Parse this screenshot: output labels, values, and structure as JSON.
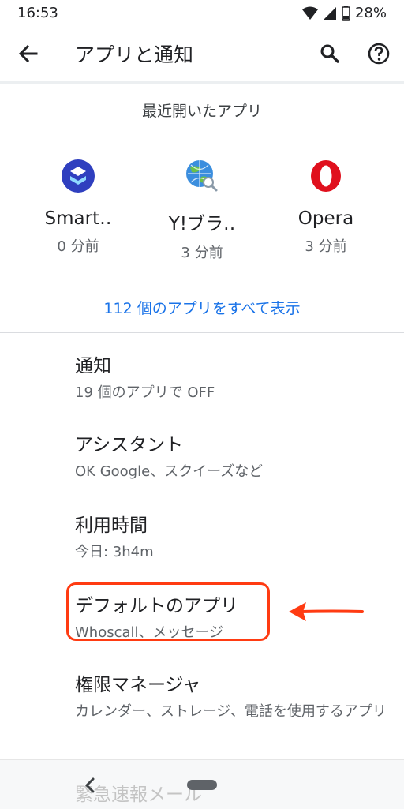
{
  "status_bar": {
    "time": "16:53",
    "battery_text": "28%",
    "icons": [
      "wifi-icon",
      "signal-icon",
      "battery-icon"
    ]
  },
  "app_bar": {
    "title": "アプリと通知",
    "icons": [
      "back-arrow-icon",
      "search-icon",
      "help-icon"
    ]
  },
  "recent_apps": {
    "header": "最近開いたアプリ",
    "items": [
      {
        "name": "Smart‥",
        "time": "0 分前",
        "icon": "smart-app-icon"
      },
      {
        "name": "Y!ブラ‥",
        "time": "3 分前",
        "icon": "yahoo-browser-icon"
      },
      {
        "name": "Opera",
        "time": "3 分前",
        "icon": "opera-icon"
      }
    ],
    "show_all": "112 個のアプリをすべて表示"
  },
  "settings": [
    {
      "title": "通知",
      "subtitle": "19 個のアプリで OFF"
    },
    {
      "title": "アシスタント",
      "subtitle": "OK Google、スクイーズなど"
    },
    {
      "title": "利用時間",
      "subtitle": "今日: 3h4m"
    },
    {
      "title": "デフォルトのアプリ",
      "subtitle": "Whoscall、メッセージ"
    },
    {
      "title": "権限マネージャ",
      "subtitle": "カレンダー、ストレージ、電話を使用するアプリ"
    }
  ],
  "ghost_item": "緊急速報メール",
  "colors": {
    "accent": "#1a73e8",
    "annotation": "#ff3b12",
    "divider": "#dadce0"
  }
}
